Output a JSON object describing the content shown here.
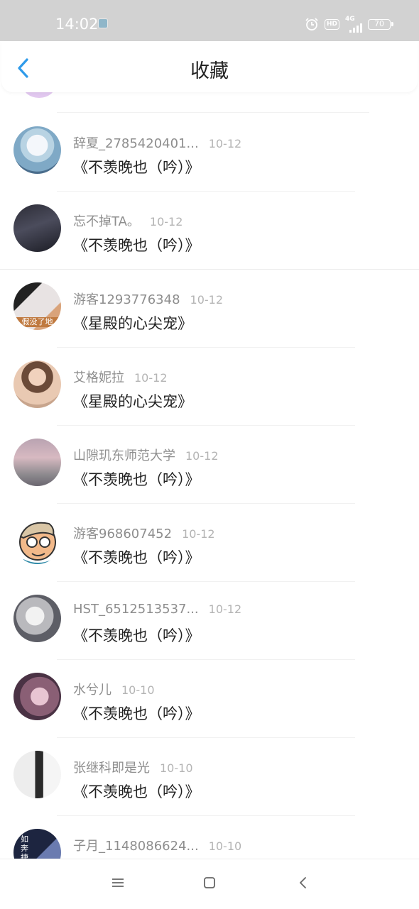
{
  "status_bar": {
    "time": "14:02",
    "hd": "HD",
    "network": "4G",
    "battery": "70"
  },
  "header": {
    "title": "收藏"
  },
  "favorites": [
    {
      "username": "辞夏_2785420401...",
      "date": "10-12",
      "book": "《不羡晚也（吟）》"
    },
    {
      "username": "忘不掉TA。",
      "date": "10-12",
      "book": "《不羡晚也（吟）》"
    },
    {
      "username": "游客1293776348",
      "date": "10-12",
      "book": "《星殿的心尖宠》"
    },
    {
      "username": "艾格妮拉",
      "date": "10-12",
      "book": "《星殿的心尖宠》"
    },
    {
      "username": "山隙玑东师范大学",
      "date": "10-12",
      "book": "《不羡晚也（吟）》"
    },
    {
      "username": "游客968607452",
      "date": "10-12",
      "book": "《不羡晚也（吟）》"
    },
    {
      "username": "HST_6512513537...",
      "date": "10-12",
      "book": "《不羡晚也（吟）》"
    },
    {
      "username": "水兮儿",
      "date": "10-10",
      "book": "《不羡晚也（吟）》"
    },
    {
      "username": "张继科即是光",
      "date": "10-10",
      "book": "《不羡晚也（吟）》"
    },
    {
      "username": "子月_1148086624...",
      "date": "10-10",
      "book": ""
    }
  ],
  "avatar_overlay_text": {
    "row3": "假没了地",
    "row10": "如奔捷"
  },
  "colors": {
    "accent": "#2f9bea",
    "status_bar_bg": "#d2d2d2",
    "username": "#8e8e8e",
    "date": "#b4b4b4",
    "title": "#222222"
  },
  "icons": {
    "back": "chevron-left-icon",
    "alarm": "alarm-clock-icon",
    "nav_menu": "menu-icon",
    "nav_home": "home-square-icon",
    "nav_back": "back-triangle-icon"
  }
}
